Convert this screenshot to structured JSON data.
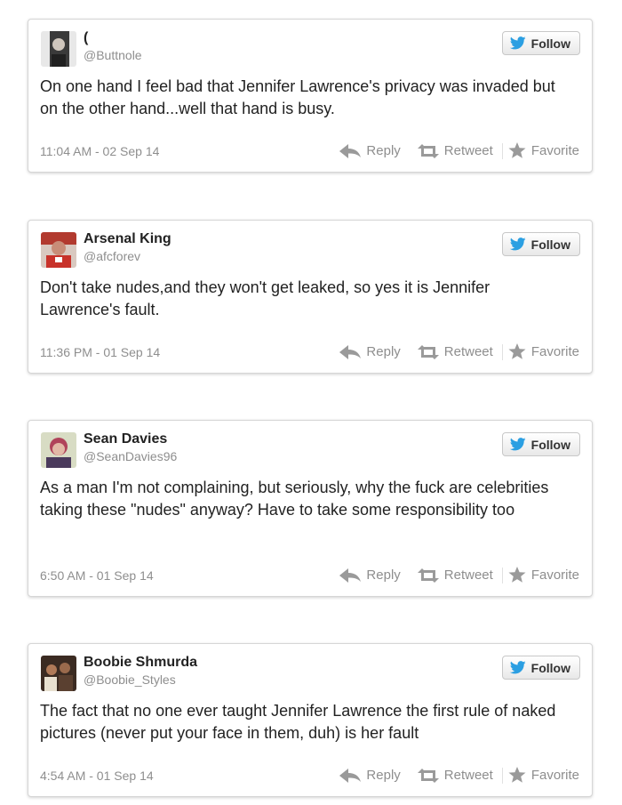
{
  "colors": {
    "follow_bird": "#2b9fe2",
    "secondary_text": "#8e8e8e",
    "card_border": "#d6d6d6"
  },
  "icons": {
    "follow": "twitter-bird-icon",
    "reply": "reply-arrow-icon",
    "retweet": "retweet-icon",
    "favorite": "star-icon"
  },
  "labels": {
    "follow": "Follow",
    "reply": "Reply",
    "retweet": "Retweet",
    "favorite": "Favorite"
  },
  "tweets": [
    {
      "name": "(",
      "handle": "@Buttnole",
      "text": "On one hand I feel bad that Jennifer Lawrence's privacy was invaded but on the other hand...well that hand is busy.",
      "timestamp": "11:04 AM - 02 Sep 14"
    },
    {
      "name": "Arsenal King",
      "handle": "@afcforev",
      "text": "Don't take nudes,and they won't get leaked, so yes it is Jennifer Lawrence's fault.",
      "timestamp": "11:36 PM - 01 Sep 14"
    },
    {
      "name": "Sean Davies",
      "handle": "@SeanDavies96",
      "text": "As a man I'm not complaining, but seriously, why the fuck are celebrities taking these \"nudes\" anyway? Have to take some responsibility too",
      "timestamp": "6:50 AM - 01 Sep 14"
    },
    {
      "name": "Boobie Shmurda",
      "handle": "@Boobie_Styles",
      "text": "The fact that no one ever taught Jennifer Lawrence the first rule of naked pictures (never put your face in them, duh) is her fault",
      "timestamp": "4:54 AM - 01 Sep 14"
    }
  ]
}
